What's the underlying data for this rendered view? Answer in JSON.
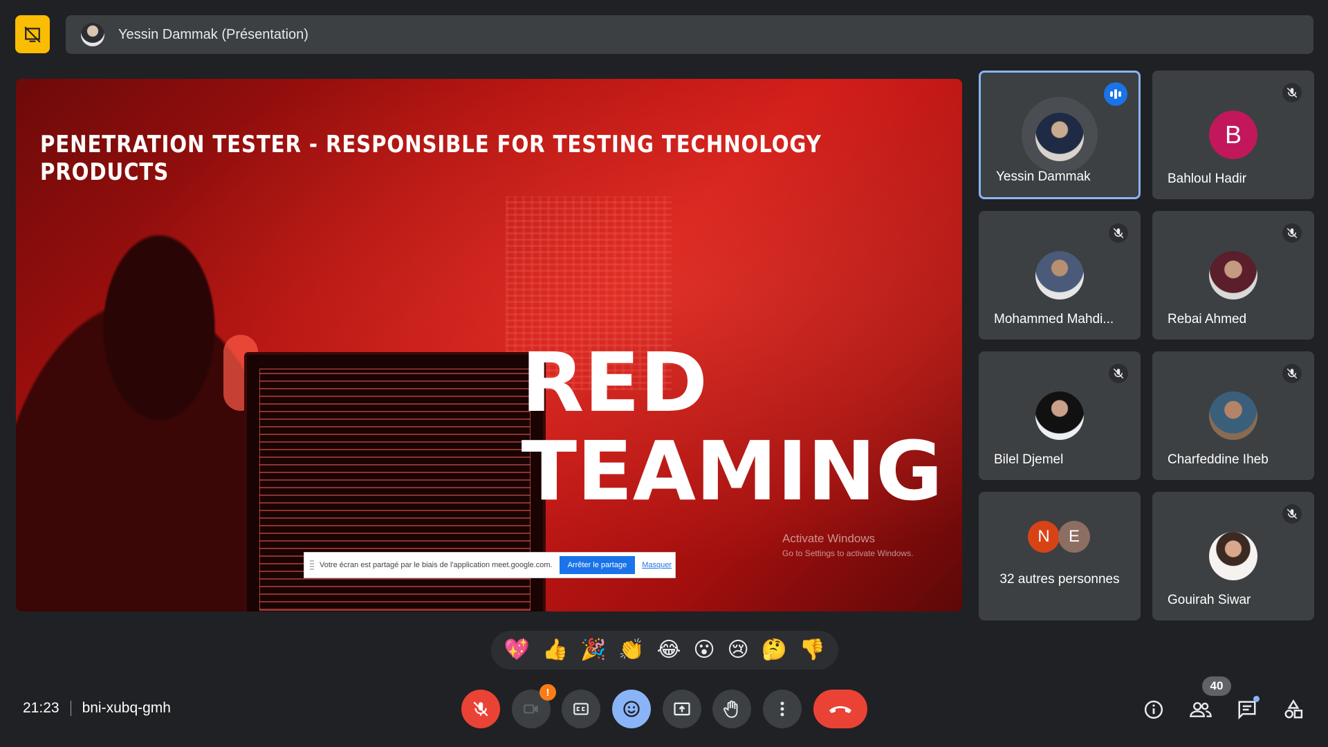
{
  "header": {
    "presenter_title": "Yessin Dammak (Présentation)"
  },
  "slide": {
    "subtitle": "Penetration Tester - Responsible for testing technology products",
    "title_line1": "RED",
    "title_line2": "TEAMING",
    "activate_line1": "Activate Windows",
    "activate_line2": "Go to Settings to activate Windows.",
    "share_text": "Votre écran est partagé par le biais de l'application meet.google.com.",
    "share_stop": "Arrêter le partage",
    "share_hide": "Masquer"
  },
  "participants": [
    {
      "name": "Yessin Dammak",
      "speaking": true
    },
    {
      "name": "Bahloul Hadir",
      "initial": "B"
    },
    {
      "name": "Mohammed Mahdi..."
    },
    {
      "name": "Rebai Ahmed"
    },
    {
      "name": "Bilel Djemel"
    },
    {
      "name": "Charfeddine Iheb"
    },
    {
      "name": "32 autres personnes",
      "initials": [
        "N",
        "E"
      ]
    },
    {
      "name": "Gouirah Siwar"
    }
  ],
  "reactions": [
    "💖",
    "👍",
    "🎉",
    "👏",
    "😂",
    "😮",
    "😢",
    "🤔",
    "👎"
  ],
  "footer": {
    "time": "21:23",
    "meeting_code": "bni-xubq-gmh",
    "camera_warning": "!",
    "participant_count": "40"
  },
  "colors": {
    "accent_blue": "#8ab4f8",
    "end_red": "#ea4335",
    "present_yellow": "#fbbc04"
  }
}
